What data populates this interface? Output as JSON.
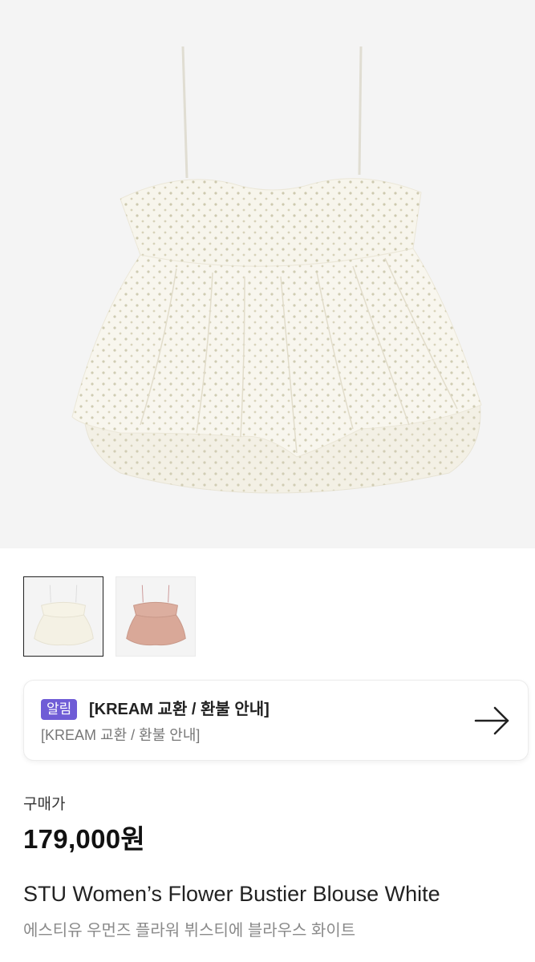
{
  "product_images": {
    "main_alt": "STU Women's Flower Bustier Blouse White",
    "thumbnails": [
      {
        "name": "white",
        "color": "#f4f1e6",
        "selected": true
      },
      {
        "name": "pink",
        "color": "#d9a898",
        "selected": false
      }
    ]
  },
  "notice": {
    "badge": "알림",
    "title": "[KREAM 교환 / 환불 안내]",
    "subtitle": "[KREAM 교환 / 환불 안내]",
    "icon": "arrow-right-icon"
  },
  "price": {
    "label": "구매가",
    "value": "179,000원"
  },
  "product": {
    "name_en": "STU Women’s Flower Bustier Blouse White",
    "name_ko": "에스티유 우먼즈 플라워 뷔스티에 블라우스 화이트"
  },
  "colors": {
    "badge": "#6f5cd6",
    "hero_bg": "#f4f4f4",
    "blouse_white": "#f6f3e8",
    "blouse_pink": "#dcae9f"
  }
}
